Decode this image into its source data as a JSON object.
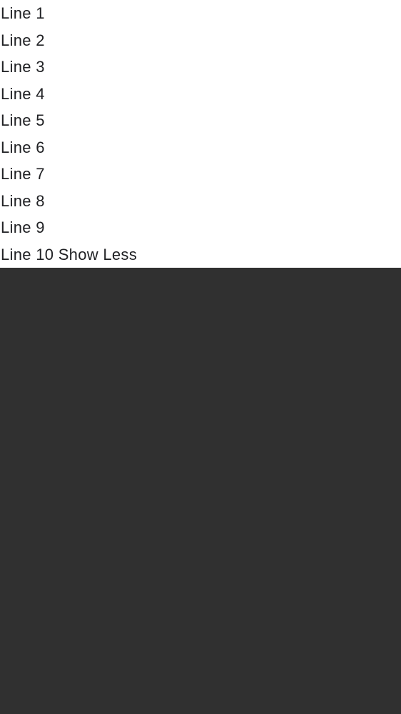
{
  "lines": [
    "Line 1",
    "Line 2",
    "Line 3",
    "Line 4",
    "Line 5",
    "Line 6",
    "Line 7",
    "Line 8",
    "Line 9",
    "Line 10"
  ],
  "toggle": {
    "label": "Show Less"
  },
  "colors": {
    "panel_background": "#ffffff",
    "page_background": "#303030",
    "text": "#202124"
  }
}
